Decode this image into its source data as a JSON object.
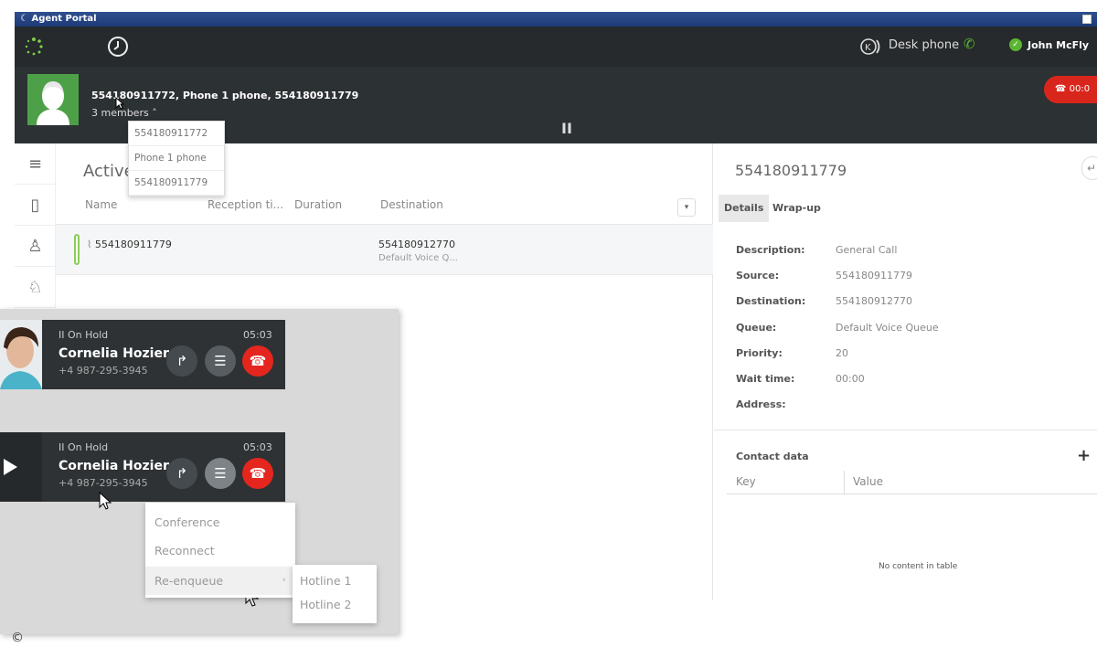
{
  "window": {
    "title": "Agent Portal"
  },
  "topbar": {
    "device_label": "Desk phone",
    "user_name": "John McFly"
  },
  "active_call": {
    "title": "554180911772, Phone 1 phone, 554180911779",
    "members_label": "3 members",
    "members": [
      "554180911772",
      "Phone 1 phone",
      "554180911779"
    ],
    "hangup_time": "00:0"
  },
  "list": {
    "title": "Active",
    "columns": [
      "Name",
      "Reception ti...",
      "Duration",
      "Destination"
    ],
    "rows": [
      {
        "name": "554180911779",
        "destination": "554180912770",
        "queue": "Default Voice Q..."
      }
    ]
  },
  "details": {
    "title": "554180911779",
    "tabs": [
      "Details",
      "Wrap-up"
    ],
    "fields": [
      {
        "label": "Description:",
        "value": "General Call"
      },
      {
        "label": "Source:",
        "value": "554180911779"
      },
      {
        "label": "Destination:",
        "value": "554180912770"
      },
      {
        "label": "Queue:",
        "value": "Default Voice Queue"
      },
      {
        "label": "Priority:",
        "value": "20"
      },
      {
        "label": "Wait time:",
        "value": "00:00"
      },
      {
        "label": "Address:",
        "value": ""
      }
    ],
    "contact_data": {
      "title": "Contact data",
      "columns": [
        "Key",
        "Value"
      ],
      "empty_text": "No content in table"
    }
  },
  "hold_cards": [
    {
      "status": "II On Hold",
      "time": "05:03",
      "name": "Cornelia Hozier",
      "number": "+4 987-295-3945"
    },
    {
      "status": "II On Hold",
      "time": "05:03",
      "name": "Cornelia Hozier",
      "number": "+4 987-295-3945"
    }
  ],
  "context_menu": {
    "items": [
      "Conference",
      "Reconnect",
      "Re-enqueue"
    ]
  },
  "submenu": {
    "items": [
      "Hotline 1",
      "Hotline 2"
    ]
  },
  "footer": {
    "copyright": "©"
  },
  "colors": {
    "accent_red": "#d9261c",
    "status_green": "#5cb531",
    "avatar_green": "#4ea048",
    "dark_bar": "#2c3133"
  }
}
